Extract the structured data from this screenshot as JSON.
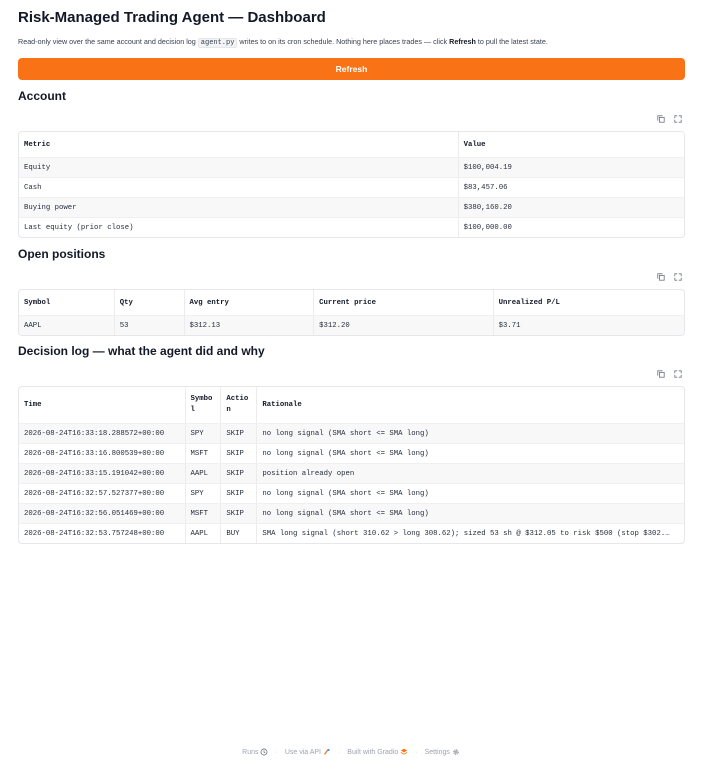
{
  "page": {
    "title": "Risk-Managed Trading Agent — Dashboard",
    "desc_pre": "Read-only view over the same account and decision log ",
    "desc_code": "agent.py",
    "desc_mid": " writes to on its cron schedule. Nothing here places trades — click ",
    "desc_bold": "Refresh",
    "desc_post": " to pull the latest state.",
    "refresh_label": "Refresh"
  },
  "account": {
    "heading": "Account",
    "columns": [
      "Metric",
      "Value"
    ],
    "rows": [
      [
        "Equity",
        "$100,004.19"
      ],
      [
        "Cash",
        "$83,457.06"
      ],
      [
        "Buying power",
        "$380,160.20"
      ],
      [
        "Last equity (prior close)",
        "$100,000.00"
      ]
    ]
  },
  "positions": {
    "heading": "Open positions",
    "columns": [
      "Symbol",
      "Qty",
      "Avg entry",
      "Current price",
      "Unrealized P/L"
    ],
    "rows": [
      [
        "AAPL",
        "53",
        "$312.13",
        "$312.20",
        "$3.71"
      ]
    ]
  },
  "log": {
    "heading": "Decision log — what the agent did and why",
    "columns": [
      "Time",
      "Symbo\nl",
      "Actio\nn",
      "Rationale"
    ],
    "rows": [
      [
        "2026-08-24T16:33:18.288572+00:00",
        "SPY",
        "SKIP",
        "no long signal (SMA short <= SMA long)"
      ],
      [
        "2026-08-24T16:33:16.800539+00:00",
        "MSFT",
        "SKIP",
        "no long signal (SMA short <= SMA long)"
      ],
      [
        "2026-08-24T16:33:15.191042+00:00",
        "AAPL",
        "SKIP",
        "position already open"
      ],
      [
        "2026-08-24T16:32:57.527377+00:00",
        "SPY",
        "SKIP",
        "no long signal (SMA short <= SMA long)"
      ],
      [
        "2026-08-24T16:32:56.051469+00:00",
        "MSFT",
        "SKIP",
        "no long signal (SMA short <= SMA long)"
      ],
      [
        "2026-08-24T16:32:53.757248+00:00",
        "AAPL",
        "BUY",
        "SMA long signal (short 310.62 > long 308.62); sized 53 sh @ $312.05 to risk $500 (stop $302.…"
      ]
    ]
  },
  "footer": {
    "runs": "Runs",
    "api": "Use via API",
    "built": "Built with Gradio",
    "settings": "Settings"
  },
  "colors": {
    "accent": "#f97316"
  },
  "icons": [
    "copy-icon",
    "fullscreen-icon",
    "runs-icon",
    "api-icon",
    "gradio-logo-icon",
    "settings-icon"
  ]
}
